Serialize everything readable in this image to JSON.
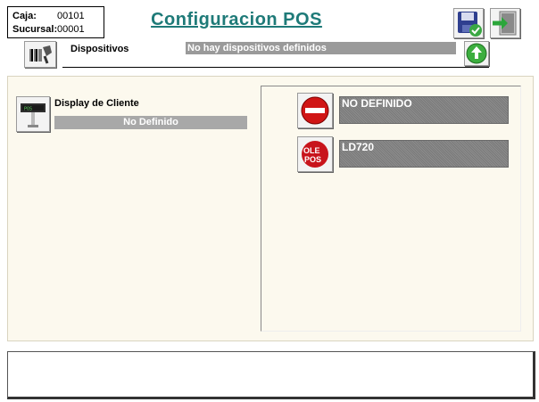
{
  "header": {
    "caja_label": "Caja:",
    "caja_value": "00101",
    "sucursal_label": "Sucursal:",
    "sucursal_value": "00001",
    "title": "Configuracion POS"
  },
  "devices_bar": {
    "label": "Dispositivos",
    "status": "No hay dispositivos definidos"
  },
  "left_panel": {
    "display_label": "Display de Cliente",
    "display_value": "No Definido"
  },
  "options": [
    {
      "label": "NO DEFINIDO",
      "icon": "no-entry-icon"
    },
    {
      "label": "LD720",
      "icon": "olepos-logo-icon"
    }
  ],
  "colors": {
    "title": "#1e7a78",
    "panel_bg": "#fcf9ee",
    "field_gray": "#9a9a9a"
  }
}
